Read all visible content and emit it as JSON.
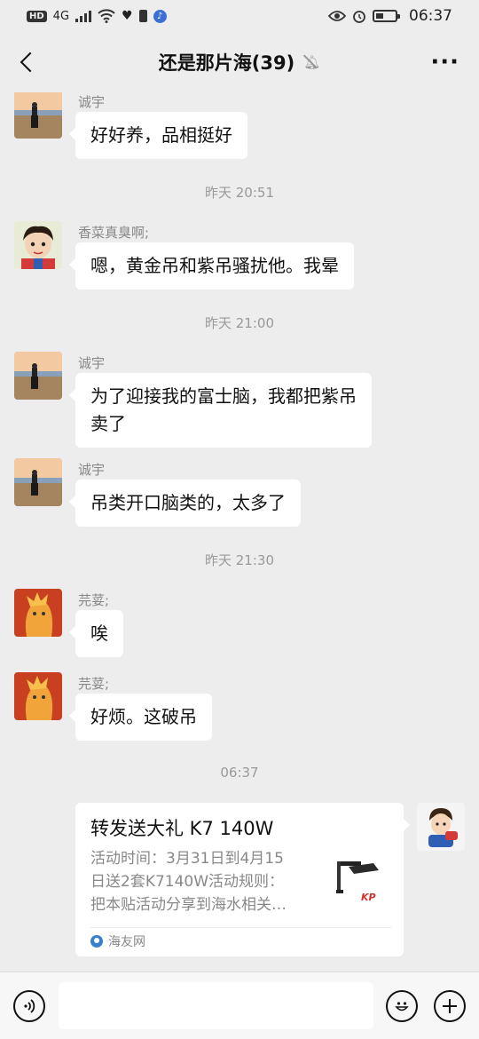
{
  "status_bar": {
    "hd_label": "HD",
    "net_label": "4G",
    "time": "06:37"
  },
  "header": {
    "title": "还是那片海(39)",
    "more": "···"
  },
  "messages": [
    {
      "sender": "诚宇",
      "lines": [
        "好好养，品相挺好"
      ]
    },
    {
      "timestamp": "昨天 20:51"
    },
    {
      "sender": "香菜真臭啊;",
      "lines": [
        "嗯，黄金吊和紫吊骚扰他。我晕"
      ]
    },
    {
      "timestamp": "昨天 21:00"
    },
    {
      "sender": "诚宇",
      "lines": [
        "为了迎接我的富士脑，我都把紫吊",
        "卖了"
      ]
    },
    {
      "sender": "诚宇",
      "lines": [
        "吊类开口脑类的，太多了"
      ]
    },
    {
      "timestamp": "昨天 21:30"
    },
    {
      "sender": "芫荽;",
      "lines": [
        "唉"
      ]
    },
    {
      "sender": "芫荽;",
      "lines": [
        "好烦。这破吊"
      ]
    },
    {
      "timestamp": "06:37"
    }
  ],
  "share_card": {
    "title": "转发送大礼 K7 140W",
    "description": [
      "活动时间：3月31日到4月15",
      "日送2套K7140W活动规则：",
      "把本贴活动分享到海水相关…"
    ],
    "thumb_logo": "KP",
    "source": "海友网"
  },
  "input_bar": {
    "message_value": ""
  },
  "colors": {
    "background": "#ededed",
    "bubble": "#ffffff",
    "secondary_text": "#888888"
  },
  "icons": [
    "voice-icon",
    "emoji-icon",
    "plus-icon",
    "mute-icon",
    "back-icon",
    "more-icon"
  ]
}
